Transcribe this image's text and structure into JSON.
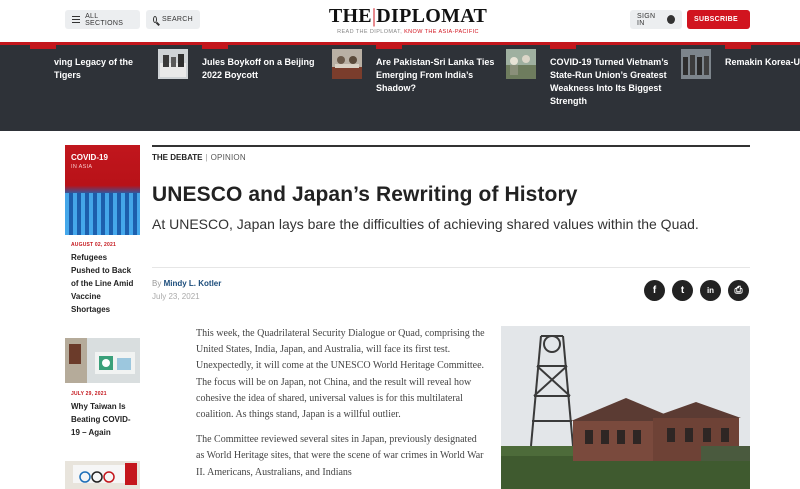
{
  "header": {
    "sections_label": "ALL SECTIONS",
    "search_label": "SEARCH",
    "logo_left": "THE",
    "logo_sep": "|",
    "logo_right": "DIPLOMAT",
    "tagline_prefix": "READ THE DIPLOMAT,",
    "tagline_accent": "KNOW THE ASIA-PACIFIC",
    "signin_label": "SIGN IN",
    "subscribe_label": "SUBSCRIBE"
  },
  "trending": [
    {
      "title": "ving Legacy of the Tigers"
    },
    {
      "title": "Jules Boykoff on a Beijing 2022 Boycott"
    },
    {
      "title": "Are Pakistan-Sri Lanka Ties Emerging From India’s Shadow?"
    },
    {
      "title": "COVID-19 Turned Vietnam’s State-Run Union’s Greatest Weakness Into Its Biggest Strength"
    },
    {
      "title": "Remakin Korea-U"
    }
  ],
  "sidebar": {
    "covid_label": "COVID-19",
    "covid_sub": "IN ASIA",
    "stories": [
      {
        "date": "AUGUST 02, 2021",
        "title": "Refugees Pushed to Back of the Line Amid Vaccine Shortages"
      },
      {
        "date": "JULY 29, 2021",
        "title": "Why Taiwan Is Beating COVID-19 – Again"
      }
    ]
  },
  "article": {
    "section": "THE DEBATE",
    "category": "OPINION",
    "headline": "UNESCO and Japan’s Rewriting of History",
    "dek": "At UNESCO, Japan lays bare the difficulties of achieving shared values within the Quad.",
    "by_prefix": "By",
    "author": "Mindy L. Kotler",
    "date": "July 23, 2021",
    "share": {
      "facebook": "f",
      "twitter": "t",
      "linkedin": "in",
      "print": "⎙"
    },
    "paragraphs": [
      "This week, the Quadrilateral Security Dialogue or Quad, comprising the United States, India, Japan, and Australia, will face its first test. Unexpectedly, it will come at the UNESCO World Heritage Committee. The focus will be on Japan, not China, and the result will reveal how cohesive the idea of shared, universal values is for this multilateral coalition. As things stand, Japan is a willful outlier.",
      "The Committee reviewed several sites in Japan, previously designated as World Heritage sites, that were the scene of war crimes in World War II. Americans, Australians, and Indians"
    ]
  },
  "colors": {
    "brand_red": "#c4161c",
    "strip_bg": "#2e3238",
    "author_link": "#1a4b7a"
  }
}
